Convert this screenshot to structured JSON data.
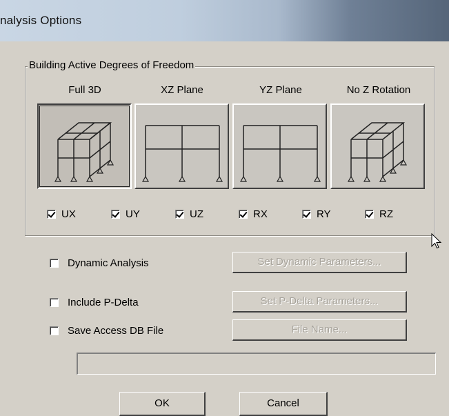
{
  "window": {
    "title": "nalysis Options"
  },
  "dof_group": {
    "label": "Building Active Degrees of Freedom",
    "views": [
      {
        "label": "Full 3D",
        "icon": "frame-3d-icon",
        "pressed": true
      },
      {
        "label": "XZ Plane",
        "icon": "frame-xz-icon",
        "pressed": false
      },
      {
        "label": "YZ Plane",
        "icon": "frame-yz-icon",
        "pressed": false
      },
      {
        "label": "No Z Rotation",
        "icon": "frame-3d-no-z-rotation-icon",
        "pressed": false
      }
    ],
    "checkboxes": [
      {
        "label": "UX",
        "checked": true
      },
      {
        "label": "UY",
        "checked": true
      },
      {
        "label": "UZ",
        "checked": true
      },
      {
        "label": "RX",
        "checked": true
      },
      {
        "label": "RY",
        "checked": true
      },
      {
        "label": "RZ",
        "checked": true
      }
    ]
  },
  "options": [
    {
      "label": "Dynamic Analysis",
      "checked": false,
      "button": "Set Dynamic Parameters...",
      "button_enabled": false
    },
    {
      "label": "Include P-Delta",
      "checked": false,
      "button": "Set P-Delta Parameters...",
      "button_enabled": false
    },
    {
      "label": "Save Access DB File",
      "checked": false,
      "button": "File Name...",
      "button_enabled": false
    }
  ],
  "file_path": {
    "value": ""
  },
  "buttons": {
    "ok": "OK",
    "cancel": "Cancel"
  },
  "colors": {
    "dialog_bg": "#d4d0c8",
    "disabled_text": "#a8a49c"
  }
}
